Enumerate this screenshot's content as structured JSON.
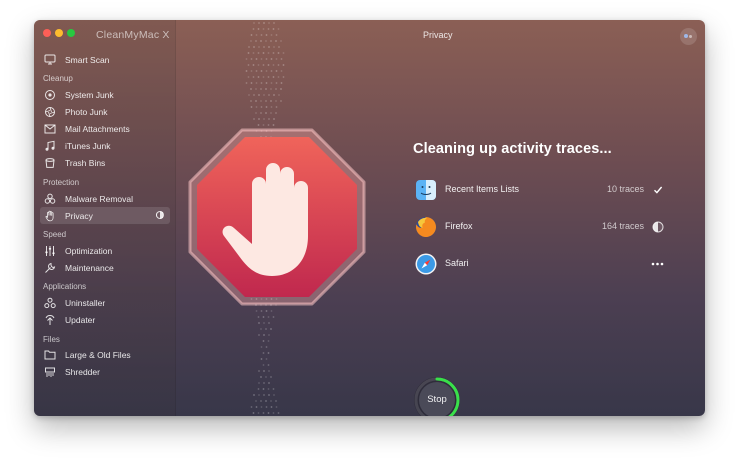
{
  "window": {
    "app_name": "CleanMyMac X",
    "title": "Privacy"
  },
  "sidebar": {
    "smart_scan": "Smart Scan",
    "sections": {
      "cleanup": "Cleanup",
      "protection": "Protection",
      "speed": "Speed",
      "applications": "Applications",
      "files": "Files"
    },
    "items": {
      "system_junk": "System Junk",
      "photo_junk": "Photo Junk",
      "mail_attachments": "Mail Attachments",
      "itunes_junk": "iTunes Junk",
      "trash_bins": "Trash Bins",
      "malware_removal": "Malware Removal",
      "privacy": "Privacy",
      "optimization": "Optimization",
      "maintenance": "Maintenance",
      "uninstaller": "Uninstaller",
      "updater": "Updater",
      "large_old_files": "Large & Old Files",
      "shredder": "Shredder"
    },
    "active_item": "privacy"
  },
  "main": {
    "heading": "Cleaning up activity traces...",
    "rows": [
      {
        "name": "Recent Items Lists",
        "traces": "10 traces",
        "status": "done",
        "icon": "finder-icon"
      },
      {
        "name": "Firefox",
        "traces": "164 traces",
        "status": "in-progress",
        "icon": "firefox-icon"
      },
      {
        "name": "Safari",
        "traces": "",
        "status": "pending",
        "icon": "safari-icon"
      }
    ],
    "stop_button": "Stop",
    "progress": 0.42
  },
  "colors": {
    "stop_sign_top": "#f0645a",
    "stop_sign_bottom": "#c0284e",
    "progress_ring": "#39e04a"
  }
}
